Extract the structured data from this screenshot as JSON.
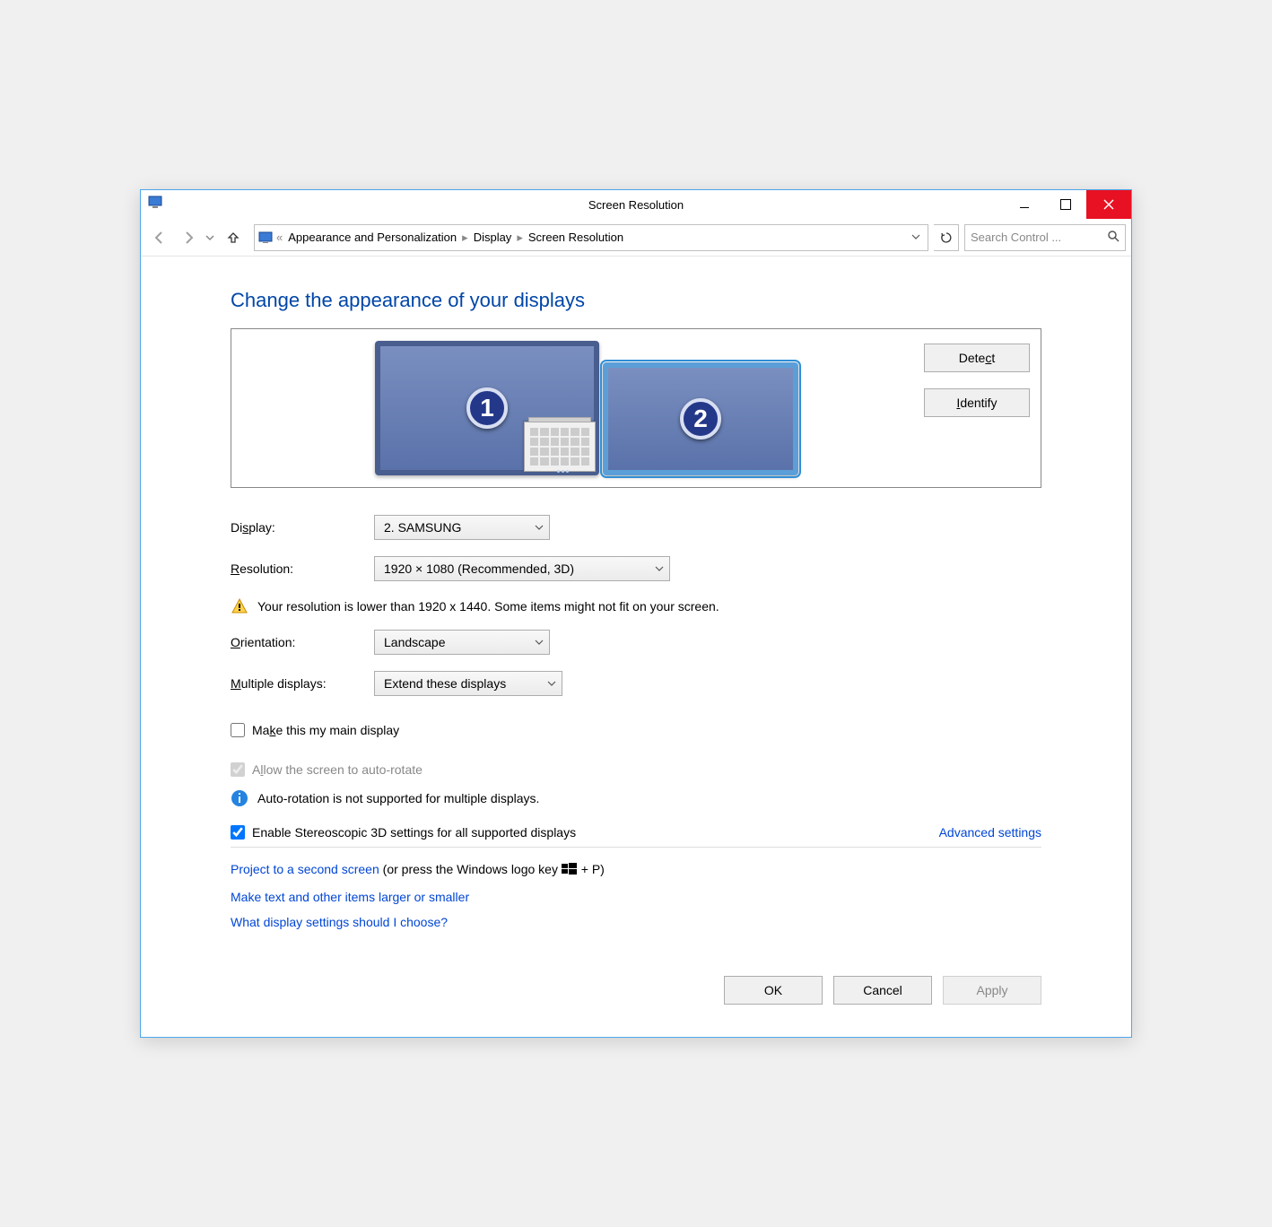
{
  "titlebar": {
    "title": "Screen Resolution"
  },
  "breadcrumb": {
    "items": [
      "Appearance and Personalization",
      "Display",
      "Screen Resolution"
    ]
  },
  "search": {
    "placeholder": "Search Control ..."
  },
  "heading": "Change the appearance of your displays",
  "monitors": [
    {
      "num": "1",
      "primary": true
    },
    {
      "num": "2",
      "primary": false,
      "selected": true
    }
  ],
  "preview_buttons": {
    "detect": "Detect",
    "identify": "Identify"
  },
  "form": {
    "display": {
      "label_pre": "Di",
      "label_u": "s",
      "label_post": "play:",
      "value": "2. SAMSUNG"
    },
    "resolution": {
      "label_u": "R",
      "label_post": "esolution:",
      "value": "1920 × 1080 (Recommended, 3D)"
    },
    "orientation": {
      "label_u": "O",
      "label_post": "rientation:",
      "value": "Landscape"
    },
    "multi": {
      "label_u": "M",
      "label_post": "ultiple displays:",
      "value": "Extend these displays"
    }
  },
  "warning": "Your resolution is lower than 1920 x 1440. Some items might not fit on your screen.",
  "checks": {
    "main": {
      "pre": "Ma",
      "u": "k",
      "post": "e this my main display",
      "checked": false
    },
    "autorotate": {
      "pre": "A",
      "u": "l",
      "post": "low the screen to auto-rotate",
      "checked": true,
      "disabled": true
    },
    "stereo": {
      "label": "Enable Stereoscopic 3D settings for all supported displays",
      "checked": true
    }
  },
  "info": "Auto-rotation is not supported for multiple displays.",
  "links": {
    "advanced": "Advanced settings",
    "project": "Project to a second screen",
    "project_suffix_pre": " (or press the Windows logo key ",
    "project_suffix_post": " + P)",
    "larger": "Make text and other items larger or smaller",
    "which": "What display settings should I choose?"
  },
  "footer": {
    "ok": "OK",
    "cancel": "Cancel",
    "apply": "Apply"
  }
}
